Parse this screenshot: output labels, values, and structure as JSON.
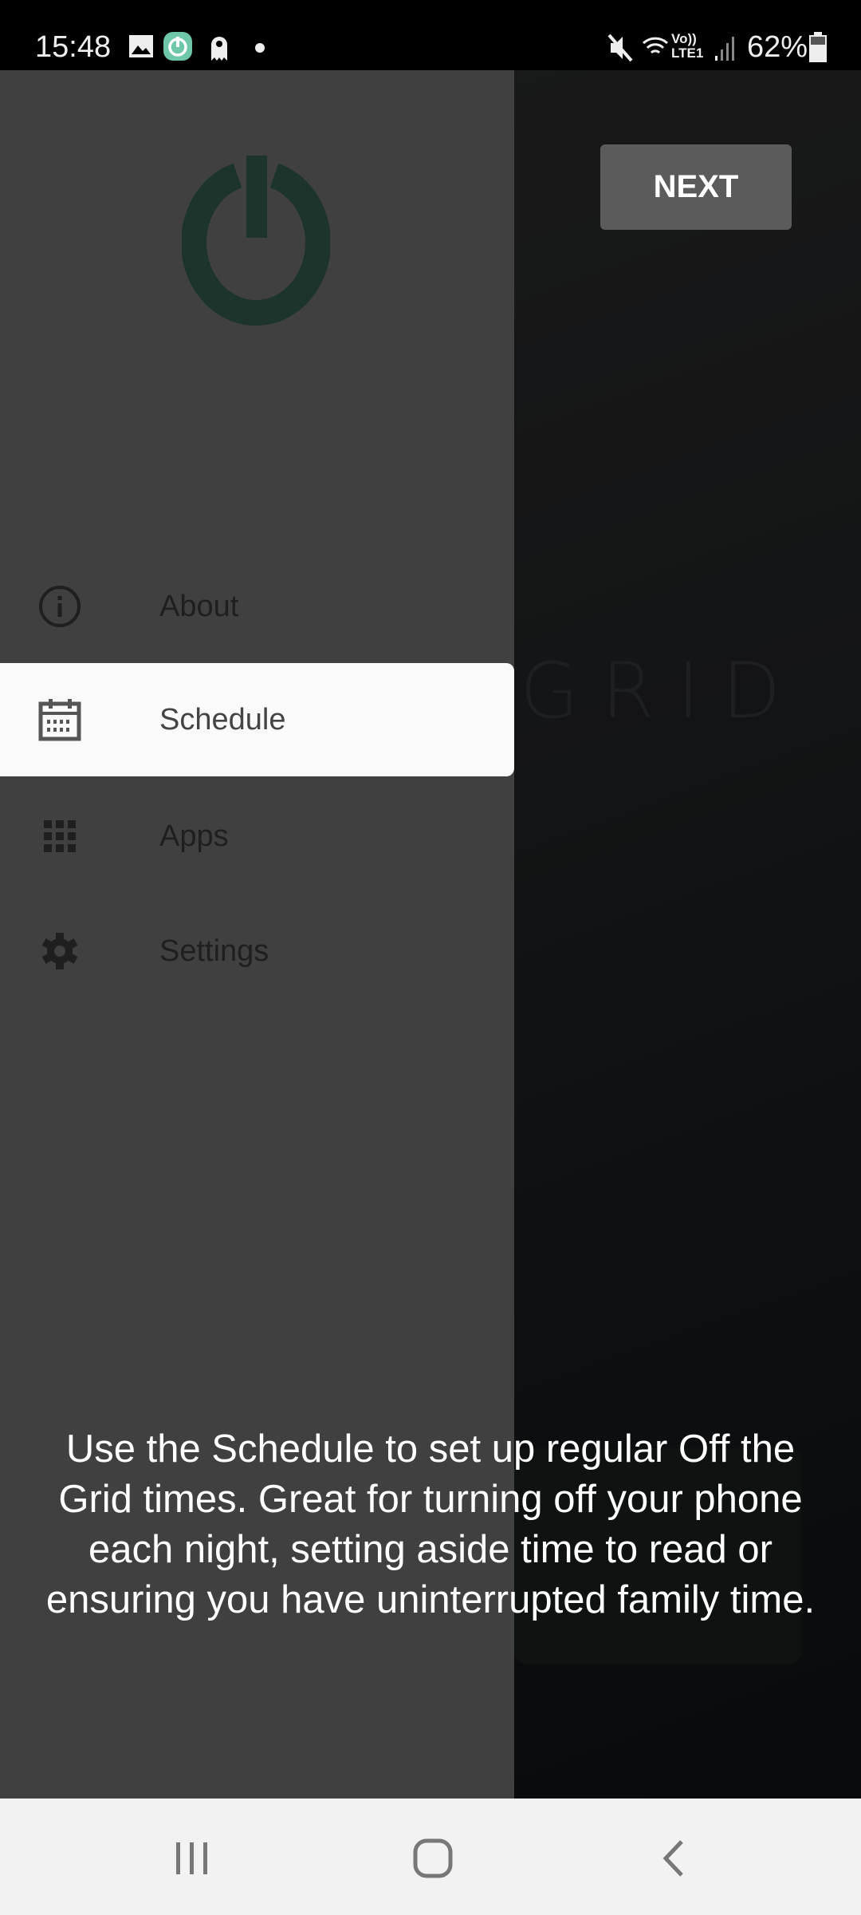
{
  "status_bar": {
    "time": "15:48",
    "battery": "62%",
    "network": "LTE1",
    "volte": "Vo))",
    "icons": [
      "gallery-icon",
      "off-the-grid-app-icon",
      "ghost-icon",
      "dot-icon",
      "mute-icon",
      "wifi-icon",
      "signal-icon",
      "battery-icon"
    ]
  },
  "background": {
    "logo_text": "GRID"
  },
  "next_button": {
    "label": "NEXT"
  },
  "drawer": {
    "logo": "power-icon",
    "logo_color": "#1c342b",
    "items": [
      {
        "label": "About",
        "icon": "info-icon",
        "active": false
      },
      {
        "label": "Schedule",
        "icon": "calendar-icon",
        "active": true
      },
      {
        "label": "Apps",
        "icon": "grid-icon",
        "active": false
      },
      {
        "label": "Settings",
        "icon": "gear-icon",
        "active": false
      }
    ]
  },
  "tutorial": {
    "message": "Use the Schedule to set up regular Off the Grid times. Great for turning off your phone each night, setting aside time to read or ensuring you have uninterrupted family time."
  },
  "nav_bar": {
    "buttons": [
      "recents-icon",
      "home-icon",
      "back-icon"
    ]
  }
}
